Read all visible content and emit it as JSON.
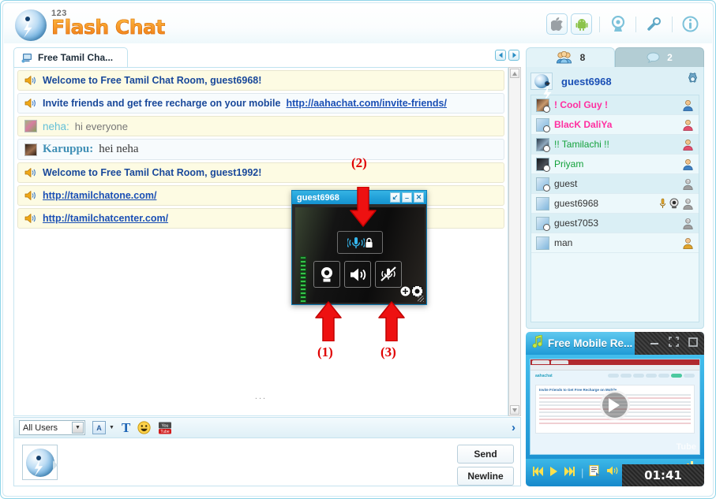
{
  "app": {
    "logo_small": "123",
    "logo_main": "Flash Chat"
  },
  "header": {
    "tools": [
      {
        "name": "apple-icon",
        "label": "Apple"
      },
      {
        "name": "android-icon",
        "label": "Android"
      },
      {
        "name": "webcam-icon",
        "label": "Webcam"
      },
      {
        "name": "wrench-icon",
        "label": "Settings"
      },
      {
        "name": "info-icon",
        "label": "Info"
      }
    ]
  },
  "chat": {
    "tab_label": "Free Tamil Cha...",
    "nav_prev": "◀",
    "nav_next": "▶",
    "scroll_dots": "...",
    "messages": [
      {
        "kind": "system",
        "icon": "speaker-icon",
        "text": "Welcome to Free Tamil Chat Room, guest6968!"
      },
      {
        "kind": "system-white",
        "icon": "speaker-icon",
        "text": "Invite friends and get free recharge on your mobile ",
        "link": "http://aahachat.com/invite-friends/"
      },
      {
        "kind": "user",
        "icon": "avatar",
        "user": "neha:",
        "text": "hi everyone"
      },
      {
        "kind": "user-serif",
        "icon": "avatar",
        "user": "Karuppu:",
        "text": "hei neha"
      },
      {
        "kind": "system",
        "icon": "speaker-icon",
        "text": "Welcome to Free Tamil Chat Room, guest1992!"
      },
      {
        "kind": "system-link",
        "icon": "speaker-icon",
        "link": "http://tamilchatone.com/"
      },
      {
        "kind": "system-link",
        "icon": "speaker-icon",
        "link": "http://tamilchatcenter.com/"
      }
    ]
  },
  "input": {
    "recipient": "All Users",
    "font_chip": "A",
    "text_icon": "T",
    "emoji_icon": "smiley-icon",
    "youtube_icon": "youtube-icon",
    "expand_icon": "›",
    "placeholder": "",
    "value": "",
    "send_label": "Send",
    "newline_label": "Newline"
  },
  "right_panel": {
    "tabs": [
      {
        "name": "users-tab",
        "icon": "users-icon",
        "count": "8",
        "active": true
      },
      {
        "name": "rooms-tab",
        "icon": "chat-bubble-icon",
        "count": "2",
        "active": false
      }
    ],
    "me": {
      "name": "guest6968",
      "gear": "gear-icon"
    },
    "users": [
      {
        "name": "! Cool Guy !",
        "color": "#ff2fa0",
        "bold": true,
        "photo": true,
        "clock": true,
        "badge": "male-icon",
        "extra": []
      },
      {
        "name": "BlacK DaliYa",
        "color": "#ff2fa0",
        "bold": true,
        "photo": false,
        "clock": true,
        "badge": "female-icon",
        "extra": []
      },
      {
        "name": "!! Tamilachi !!",
        "color": "#12a13a",
        "bold": false,
        "photo": true,
        "clock": true,
        "badge": "female-icon",
        "extra": []
      },
      {
        "name": "Priyam",
        "color": "#12a13a",
        "bold": false,
        "photo": true,
        "clock": true,
        "badge": "male-icon",
        "extra": []
      },
      {
        "name": "guest",
        "color": "#333333",
        "bold": false,
        "photo": false,
        "clock": true,
        "badge": "unknown-icon",
        "extra": []
      },
      {
        "name": "guest6968",
        "color": "#333333",
        "bold": false,
        "photo": false,
        "clock": false,
        "badge": "unknown-icon",
        "extra": [
          "mic-icon",
          "webcam-icon"
        ]
      },
      {
        "name": "guest7053",
        "color": "#333333",
        "bold": false,
        "photo": false,
        "clock": true,
        "badge": "unknown-icon",
        "extra": []
      },
      {
        "name": "man",
        "color": "#333333",
        "bold": false,
        "photo": false,
        "clock": false,
        "badge": "male-icon",
        "extra": []
      }
    ]
  },
  "player": {
    "title": "Free Mobile Re...",
    "title_icon": "music-note-icon",
    "time": "01:41",
    "window_controls": [
      "minimize-icon",
      "expand-icon",
      "restore-icon"
    ],
    "controls": [
      "prev-icon",
      "play-icon",
      "next-icon",
      "playlist-icon",
      "volume-icon"
    ],
    "thumb": {
      "site_logo": "aahachat",
      "heading": "Invite Friends to Get Free Recharge on Mobile",
      "watermark": "Tube"
    }
  },
  "webcam": {
    "title": "guest6968",
    "controls": [
      {
        "name": "restore-icon",
        "glyph": "↙"
      },
      {
        "name": "minimize-icon",
        "glyph": "–"
      },
      {
        "name": "close-icon",
        "glyph": "✕"
      }
    ],
    "buttons": [
      {
        "name": "mic-lock-button",
        "icon": "mic-lock-icon"
      },
      {
        "name": "webcam-button",
        "icon": "webcam-icon"
      },
      {
        "name": "speaker-button",
        "icon": "speaker-icon"
      },
      {
        "name": "mute-mic-button",
        "icon": "mic-muted-icon"
      }
    ],
    "corner": [
      "zoom-in-icon",
      "fullscreen-icon"
    ]
  },
  "annotations": [
    {
      "label": "(1)",
      "direction": "up"
    },
    {
      "label": "(2)",
      "direction": "down"
    },
    {
      "label": "(3)",
      "direction": "up"
    }
  ],
  "colors": {
    "accent": "#1f9ad6",
    "panel": "#ddf0f6",
    "system_msg_bg": "#fdfbe3",
    "link": "#1a4fb5",
    "annotation": "#e00000"
  }
}
